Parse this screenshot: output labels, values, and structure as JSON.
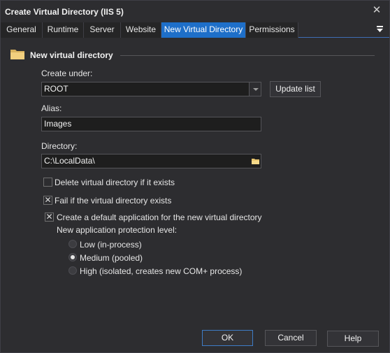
{
  "window": {
    "title": "Create Virtual Directory (IIS 5)",
    "close_glyph": "✕"
  },
  "tabs": [
    {
      "label": "General"
    },
    {
      "label": "Runtime"
    },
    {
      "label": "Server"
    },
    {
      "label": "Website"
    },
    {
      "label": "New Virtual Directory",
      "active": true
    },
    {
      "label": "Permissions"
    }
  ],
  "section": {
    "title": "New virtual directory",
    "icon": "folder-icon"
  },
  "create_under": {
    "label": "Create under:",
    "value": "ROOT",
    "update_button": "Update list"
  },
  "alias": {
    "label": "Alias:",
    "value": "Images"
  },
  "directory": {
    "label": "Directory:",
    "value": "C:\\LocalData\\"
  },
  "options": {
    "delete_existing": {
      "label": "Delete virtual directory if it exists",
      "checked": false
    },
    "fail_if_exists": {
      "label": "Fail if the virtual directory exists",
      "checked": true
    },
    "create_app": {
      "label": "Create a default application for the new virtual directory",
      "checked": true
    }
  },
  "protection": {
    "label": "New application protection level:",
    "options": [
      {
        "label": "Low (in-process)",
        "checked": false
      },
      {
        "label": "Medium (pooled)",
        "checked": true
      },
      {
        "label": "High (isolated, creates new COM+ process)",
        "checked": false
      }
    ]
  },
  "buttons": {
    "ok": "OK",
    "cancel": "Cancel",
    "help": "Help"
  },
  "colors": {
    "accent": "#1e6fc9",
    "background": "#2d2d30"
  }
}
